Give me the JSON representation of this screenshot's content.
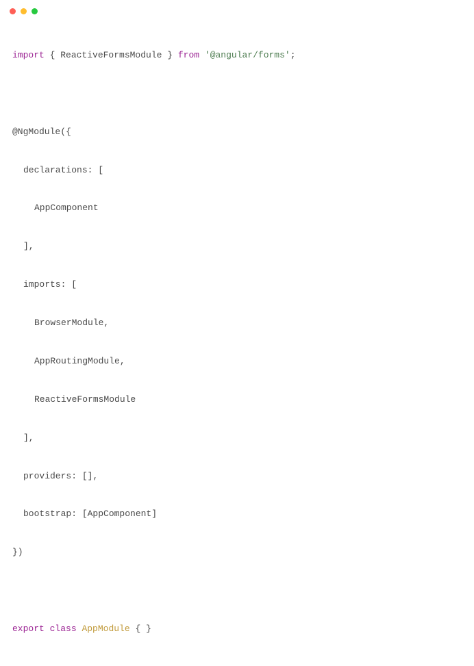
{
  "code": {
    "line1": {
      "kw_import": "import",
      "braces": " { ReactiveFormsModule } ",
      "kw_from": "from",
      "space": " ",
      "string": "'@angular/forms'",
      "semi": ";"
    },
    "line2": {
      "decorator": "@NgModule({"
    },
    "line3": {
      "text": "declarations: ["
    },
    "line4": {
      "text": "AppComponent"
    },
    "line5": {
      "text": "],"
    },
    "line6": {
      "text": "imports: ["
    },
    "line7": {
      "text": "BrowserModule,"
    },
    "line8": {
      "text": "AppRoutingModule,"
    },
    "line9": {
      "text": "ReactiveFormsModule"
    },
    "line10": {
      "text": "],"
    },
    "line11": {
      "text": "providers: [],"
    },
    "line12": {
      "text": "bootstrap: [AppComponent]"
    },
    "line13": {
      "text": "})"
    },
    "line14": {
      "kw_export": "export",
      "space1": " ",
      "kw_class": "class",
      "space2": " ",
      "classname": "AppModule",
      "rest": " { }"
    }
  }
}
